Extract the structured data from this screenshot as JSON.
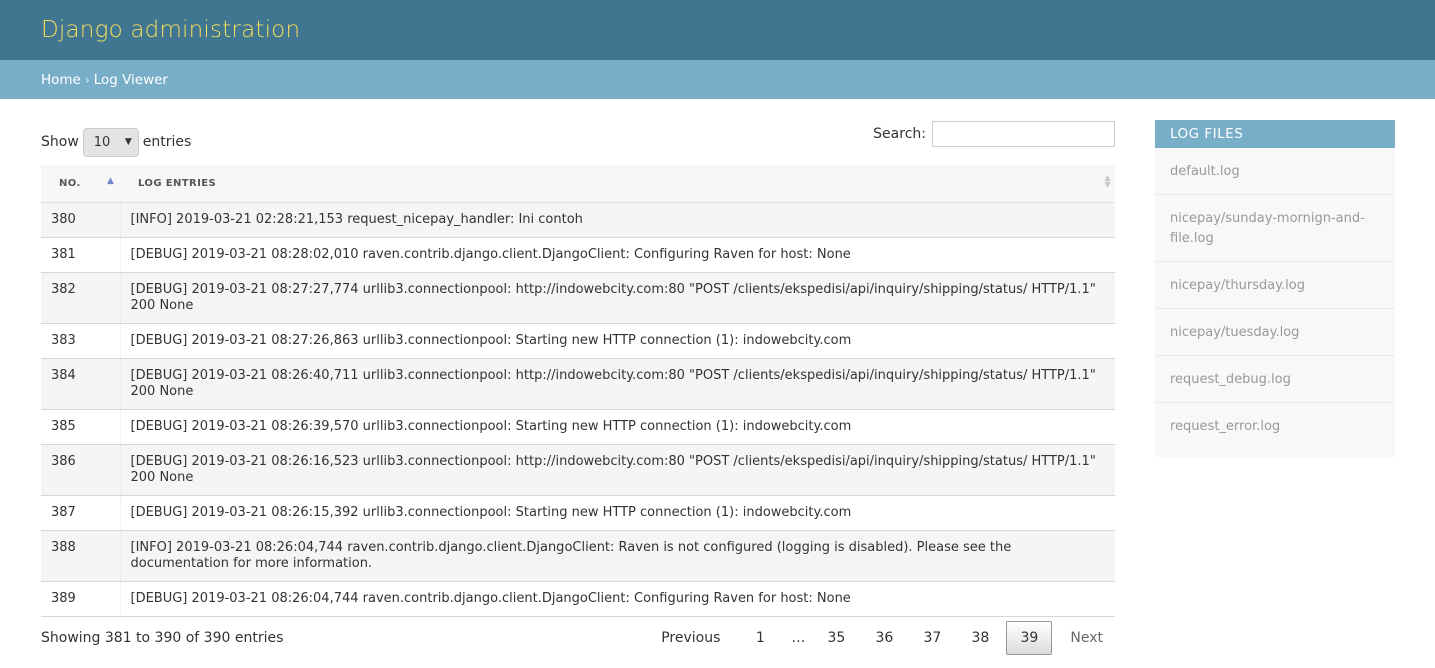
{
  "header": {
    "site_name": "Django administration"
  },
  "breadcrumbs": {
    "home": "Home",
    "separator": "›",
    "current": "Log Viewer"
  },
  "controls": {
    "show_label": "Show",
    "entries_label": "entries",
    "page_length": "10",
    "search_label": "Search:",
    "search_value": ""
  },
  "table": {
    "headers": {
      "no": "NO.",
      "entries": "LOG ENTRIES"
    },
    "rows": [
      {
        "no": "380",
        "entry": "[INFO] 2019-03-21 02:28:21,153 request_nicepay_handler: Ini contoh"
      },
      {
        "no": "381",
        "entry": "[DEBUG] 2019-03-21 08:28:02,010 raven.contrib.django.client.DjangoClient: Configuring Raven for host: None"
      },
      {
        "no": "382",
        "entry": "[DEBUG] 2019-03-21 08:27:27,774 urllib3.connectionpool: http://indowebcity.com:80 \"POST /clients/ekspedisi/api/inquiry/shipping/status/ HTTP/1.1\" 200 None"
      },
      {
        "no": "383",
        "entry": "[DEBUG] 2019-03-21 08:27:26,863 urllib3.connectionpool: Starting new HTTP connection (1): indowebcity.com"
      },
      {
        "no": "384",
        "entry": "[DEBUG] 2019-03-21 08:26:40,711 urllib3.connectionpool: http://indowebcity.com:80 \"POST /clients/ekspedisi/api/inquiry/shipping/status/ HTTP/1.1\" 200 None"
      },
      {
        "no": "385",
        "entry": "[DEBUG] 2019-03-21 08:26:39,570 urllib3.connectionpool: Starting new HTTP connection (1): indowebcity.com"
      },
      {
        "no": "386",
        "entry": "[DEBUG] 2019-03-21 08:26:16,523 urllib3.connectionpool: http://indowebcity.com:80 \"POST /clients/ekspedisi/api/inquiry/shipping/status/ HTTP/1.1\" 200 None"
      },
      {
        "no": "387",
        "entry": "[DEBUG] 2019-03-21 08:26:15,392 urllib3.connectionpool: Starting new HTTP connection (1): indowebcity.com"
      },
      {
        "no": "388",
        "entry": "[INFO] 2019-03-21 08:26:04,744 raven.contrib.django.client.DjangoClient: Raven is not configured (logging is disabled). Please see the documentation for more information."
      },
      {
        "no": "389",
        "entry": "[DEBUG] 2019-03-21 08:26:04,744 raven.contrib.django.client.DjangoClient: Configuring Raven for host: None"
      }
    ]
  },
  "footer": {
    "info": "Showing 381 to 390 of 390 entries",
    "pagination": {
      "previous": "Previous",
      "pages": [
        "1",
        "…",
        "35",
        "36",
        "37",
        "38",
        "39"
      ],
      "current": "39",
      "next": "Next"
    }
  },
  "sidebar": {
    "title": "LOG FILES",
    "files": [
      "default.log",
      "nicepay/sunday-mornign-and-file.log",
      "nicepay/thursday.log",
      "nicepay/tuesday.log",
      "request_debug.log",
      "request_error.log"
    ]
  }
}
